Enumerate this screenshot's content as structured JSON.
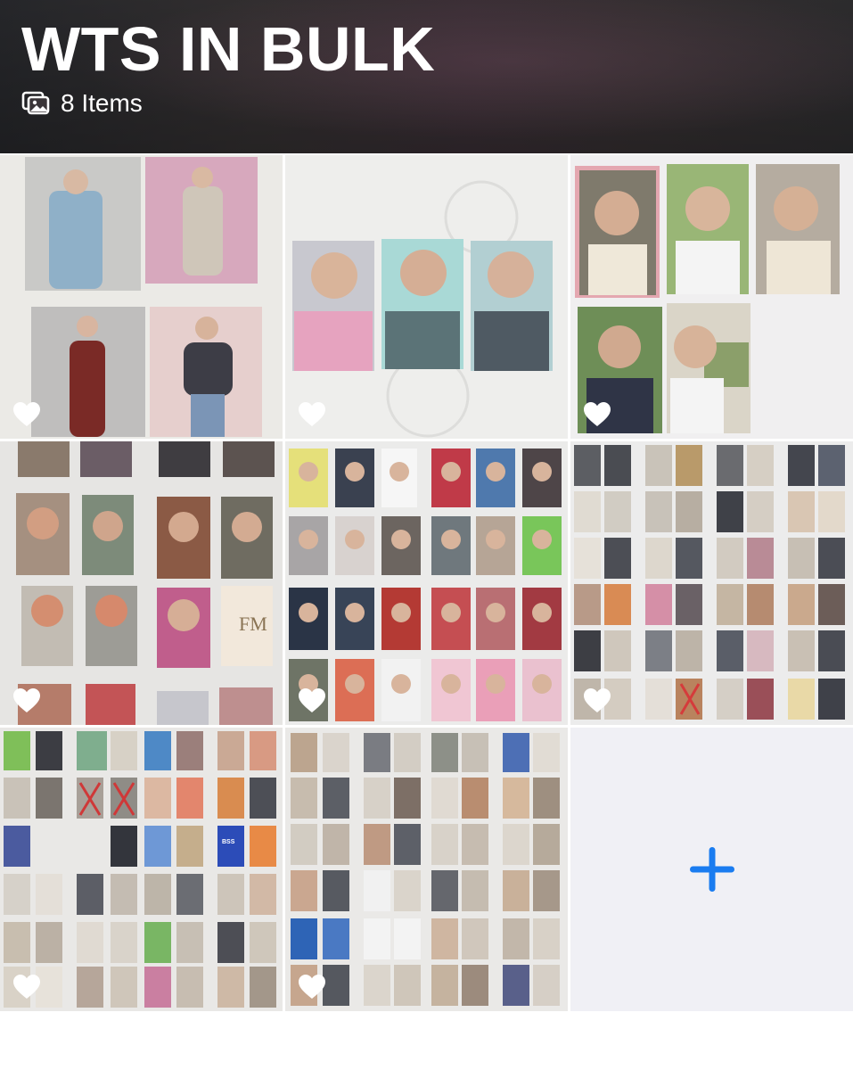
{
  "album": {
    "title": "WTS IN BULK",
    "item_count_text": "8 Items"
  },
  "icons": {
    "items": "photo-stack-icon",
    "favorite": "heart-icon",
    "add": "plus-icon"
  },
  "colors": {
    "accent": "#1a7cf0",
    "add_tile_bg": "#f0f0f5",
    "heart": "#ffffff"
  },
  "items": [
    {
      "id": 1,
      "favorite": false
    },
    {
      "id": 2,
      "favorite": false
    },
    {
      "id": 3,
      "favorite": false
    },
    {
      "id": 4,
      "favorite": false
    },
    {
      "id": 5,
      "favorite": false
    },
    {
      "id": 6,
      "favorite": false
    },
    {
      "id": 7,
      "favorite": false
    },
    {
      "id": 8,
      "favorite": false
    }
  ]
}
